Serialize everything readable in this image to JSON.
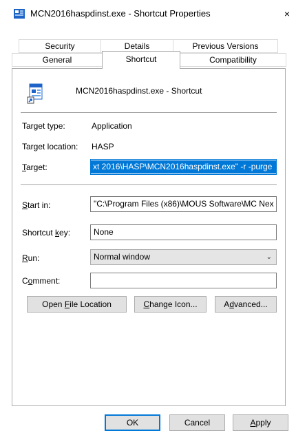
{
  "window": {
    "title": "MCN2016haspdinst.exe - Shortcut Properties",
    "close_glyph": "×",
    "icon": "shortcut-icon"
  },
  "tabs": {
    "row1": [
      "Security",
      "Details",
      "Previous Versions"
    ],
    "row2": [
      "General",
      "Shortcut",
      "Compatibility"
    ],
    "active": "Shortcut"
  },
  "shortcut": {
    "name": "MCN2016haspdinst.exe - Shortcut",
    "target_type_label": "Target type:",
    "target_type_value": "Application",
    "target_location_label": "Target location:",
    "target_location_value": "HASP",
    "target_label_underline": "T",
    "target_label_rest": "arget:",
    "target_value": "xt 2016\\HASP\\MCN2016haspdinst.exe\" -r -purge",
    "start_in_label_underline": "S",
    "start_in_label_rest": "tart in:",
    "start_in_value": "\"C:\\Program Files (x86)\\MOUS Software\\MC Nex",
    "shortcut_key_label_pre": "Shortcut ",
    "shortcut_key_label_underline": "k",
    "shortcut_key_label_rest": "ey:",
    "shortcut_key_value": "None",
    "run_label_underline": "R",
    "run_label_rest": "un:",
    "run_value": "Normal window",
    "comment_label_pre": "C",
    "comment_label_underline": "o",
    "comment_label_rest": "mment:",
    "comment_value": ""
  },
  "action_buttons": {
    "open_location_pre": "Open ",
    "open_location_underline": "F",
    "open_location_rest": "ile Location",
    "change_icon_underline": "C",
    "change_icon_rest": "hange Icon...",
    "advanced_pre": "A",
    "advanced_underline": "d",
    "advanced_rest": "vanced..."
  },
  "dialog_buttons": {
    "ok": "OK",
    "cancel": "Cancel",
    "apply_underline": "A",
    "apply_rest": "pply"
  },
  "colors": {
    "accent": "#0078d7",
    "button_face": "#e1e1e1",
    "border": "#adadad"
  }
}
